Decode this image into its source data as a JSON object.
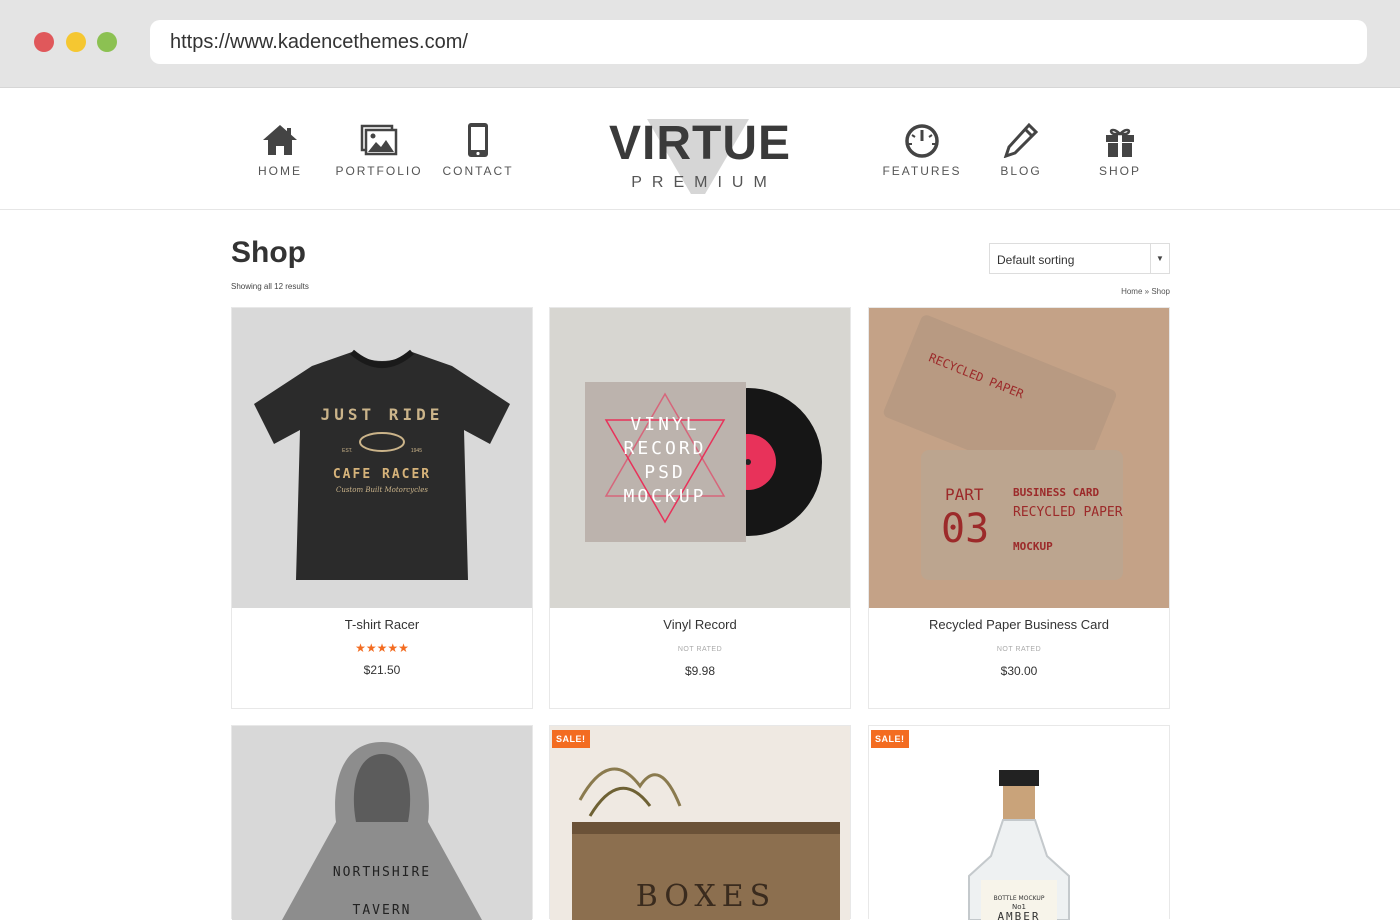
{
  "browser": {
    "url": "https://www.kadencethemes.com/"
  },
  "nav": {
    "left": [
      {
        "label": "HOME",
        "icon": "home-icon"
      },
      {
        "label": "PORTFOLIO",
        "icon": "image-icon"
      },
      {
        "label": "CONTACT",
        "icon": "phone-icon"
      }
    ],
    "right": [
      {
        "label": "FEATURES",
        "icon": "gauge-icon"
      },
      {
        "label": "BLOG",
        "icon": "pencil-icon"
      },
      {
        "label": "SHOP",
        "icon": "gift-icon"
      }
    ]
  },
  "logo": {
    "title": "VIRTUE",
    "subtitle": "PREMIUM"
  },
  "shop": {
    "title": "Shop",
    "results": "Showing all 12 results",
    "sort_selected": "Default sorting",
    "breadcrumb": "Home » Shop"
  },
  "products": [
    {
      "name": "T-shirt Racer",
      "rating": "★★★★★",
      "price": "$21.50",
      "img_text": [
        "JUST RIDE",
        "EST.",
        "1945",
        "CAFE RACER",
        "Custom Built Motorcycles"
      ]
    },
    {
      "name": "Vinyl Record",
      "rating_text": "NOT RATED",
      "price": "$9.98",
      "img_text": [
        "VINYL",
        "RECORD",
        "PSD",
        "MOCKUP"
      ]
    },
    {
      "name": "Recycled Paper Business Card",
      "rating_text": "NOT RATED",
      "price": "$30.00",
      "img_text": [
        "RECYCLED PAPER",
        "PART",
        "03",
        "BUSINESS CARD",
        "RECYCLED PAPER",
        "MOCKUP"
      ]
    },
    {
      "name": "",
      "img_text": [
        "NORTHSHIRE",
        "TAVERN"
      ]
    },
    {
      "name": "",
      "sale": "SALE!",
      "img_text": [
        "BOXES"
      ]
    },
    {
      "name": "",
      "sale": "SALE!",
      "img_text": [
        "BOTTLE MOCKUP",
        "No1",
        "AMBER"
      ]
    }
  ],
  "colors": {
    "accent": "#f36c21",
    "chrome_bg": "#e4e4e4",
    "text": "#333333"
  }
}
